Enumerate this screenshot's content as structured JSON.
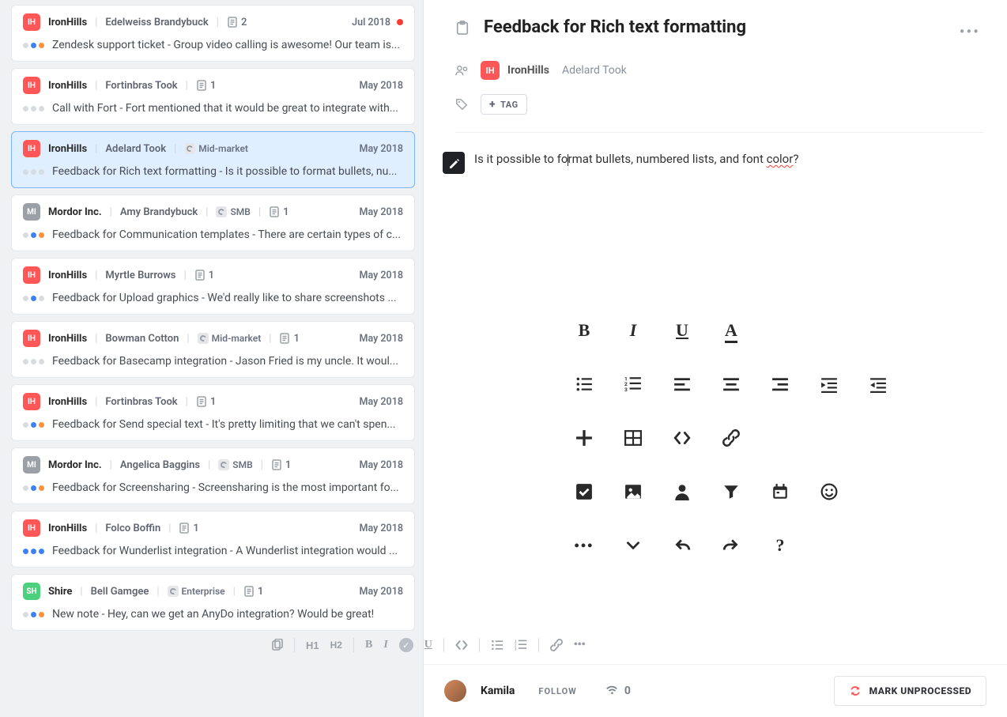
{
  "list": [
    {
      "orgCode": "IH",
      "orgClass": "org-ih",
      "org": "IronHills",
      "contact": "Edelweiss Brandybuck",
      "segment": null,
      "count": "2",
      "date": "Jul 2018",
      "redDot": true,
      "dotPattern": [
        "light",
        "blue",
        "orange"
      ],
      "summary": "Zendesk support ticket - Group video calling is awesome! Our team is...",
      "selected": false
    },
    {
      "orgCode": "IH",
      "orgClass": "org-ih",
      "org": "IronHills",
      "contact": "Fortinbras Took",
      "segment": null,
      "count": "1",
      "date": "May 2018",
      "redDot": false,
      "dotPattern": [
        "light",
        "light",
        "light"
      ],
      "summary": "Call with Fort - Fort mentioned that it would be great to integrate with...",
      "selected": false
    },
    {
      "orgCode": "IH",
      "orgClass": "org-ih",
      "org": "IronHills",
      "contact": "Adelard Took",
      "segment": "Mid-market",
      "count": null,
      "date": "May 2018",
      "redDot": false,
      "dotPattern": [
        "light",
        "light",
        "light"
      ],
      "summary": "Feedback for Rich text formatting - Is it possible to format bullets, nu...",
      "selected": true
    },
    {
      "orgCode": "MI",
      "orgClass": "org-mi",
      "org": "Mordor Inc.",
      "contact": "Amy Brandybuck",
      "segment": "SMB",
      "count": "1",
      "date": "May 2018",
      "redDot": false,
      "dotPattern": [
        "light",
        "blue",
        "orange"
      ],
      "summary": "Feedback for Communication templates - There are certain types of c...",
      "selected": false
    },
    {
      "orgCode": "IH",
      "orgClass": "org-ih",
      "org": "IronHills",
      "contact": "Myrtle Burrows",
      "segment": null,
      "count": "1",
      "date": "May 2018",
      "redDot": false,
      "dotPattern": [
        "light",
        "blue",
        "light"
      ],
      "summary": "Feedback for Upload graphics - We'd really like to share screenshots ...",
      "selected": false
    },
    {
      "orgCode": "IH",
      "orgClass": "org-ih",
      "org": "IronHills",
      "contact": "Bowman Cotton",
      "segment": "Mid-market",
      "count": "1",
      "date": "May 2018",
      "redDot": false,
      "dotPattern": [
        "light",
        "light",
        "light"
      ],
      "summary": "Feedback for Basecamp integration - Jason Fried is my uncle. It woul...",
      "selected": false
    },
    {
      "orgCode": "IH",
      "orgClass": "org-ih",
      "org": "IronHills",
      "contact": "Fortinbras Took",
      "segment": null,
      "count": "1",
      "date": "May 2018",
      "redDot": false,
      "dotPattern": [
        "light",
        "blue",
        "orange"
      ],
      "summary": "Feedback for Send special text - It's pretty limiting that we can't spen...",
      "selected": false
    },
    {
      "orgCode": "MI",
      "orgClass": "org-mi",
      "org": "Mordor Inc.",
      "contact": "Angelica Baggins",
      "segment": "SMB",
      "count": "1",
      "date": "May 2018",
      "redDot": false,
      "dotPattern": [
        "light",
        "blue",
        "orange"
      ],
      "summary": "Feedback for Screensharing - Screensharing is the most important fo...",
      "selected": false
    },
    {
      "orgCode": "IH",
      "orgClass": "org-ih",
      "org": "IronHills",
      "contact": "Folco Boffin",
      "segment": null,
      "count": "1",
      "date": "May 2018",
      "redDot": false,
      "dotPattern": [
        "blue",
        "blue",
        "blue"
      ],
      "summary": "Feedback for Wunderlist integration - A Wunderlist integration would ...",
      "selected": false
    },
    {
      "orgCode": "SH",
      "orgClass": "org-sh",
      "org": "Shire",
      "contact": "Bell Gamgee",
      "segment": "Enterprise",
      "count": "1",
      "date": "May 2018",
      "redDot": false,
      "dotPattern": [
        "light",
        "blue",
        "orange"
      ],
      "summary": "New note - Hey, can we get an AnyDo integration? Would be great!",
      "selected": false
    }
  ],
  "detail": {
    "title": "Feedback for Rich text formatting",
    "org": "IronHills",
    "orgCode": "IH",
    "contact": "Adelard Took",
    "addTag": "TAG",
    "bodyPrefix": "Is it possible to fo",
    "bodyMid": "rmat bullets, numbered lists, and font ",
    "bodySquiggle": "color",
    "bodySuffix": "?"
  },
  "palette": [
    [
      {
        "name": "bold-button",
        "kind": "char",
        "val": "B",
        "style": "font-weight:800;"
      },
      {
        "name": "italic-button",
        "kind": "char",
        "val": "I",
        "style": "font-style:italic;font-family:Georgia,serif;"
      },
      {
        "name": "underline-button",
        "kind": "uchar",
        "val": "U"
      },
      {
        "name": "font-color-button",
        "kind": "aul",
        "val": "A"
      },
      {
        "name": "",
        "kind": "empty"
      },
      {
        "name": "",
        "kind": "empty"
      },
      {
        "name": "",
        "kind": "empty"
      }
    ],
    [
      {
        "name": "bullet-list-button",
        "kind": "svg",
        "svg": "list-ul"
      },
      {
        "name": "number-list-button",
        "kind": "svg",
        "svg": "list-ol"
      },
      {
        "name": "align-left-button",
        "kind": "svg",
        "svg": "align-left"
      },
      {
        "name": "align-center-button",
        "kind": "svg",
        "svg": "align-center"
      },
      {
        "name": "align-right-button",
        "kind": "svg",
        "svg": "align-right"
      },
      {
        "name": "indent-in-button",
        "kind": "svg",
        "svg": "indent"
      },
      {
        "name": "indent-out-button",
        "kind": "svg",
        "svg": "outdent"
      }
    ],
    [
      {
        "name": "insert-button",
        "kind": "svg",
        "svg": "plus"
      },
      {
        "name": "table-button",
        "kind": "svg",
        "svg": "table"
      },
      {
        "name": "code-button",
        "kind": "svg",
        "svg": "code"
      },
      {
        "name": "link-button",
        "kind": "svg",
        "svg": "link"
      },
      {
        "name": "",
        "kind": "empty"
      },
      {
        "name": "",
        "kind": "empty"
      },
      {
        "name": "",
        "kind": "empty"
      }
    ],
    [
      {
        "name": "checkbox-button",
        "kind": "svg",
        "svg": "checkbox"
      },
      {
        "name": "image-button",
        "kind": "svg",
        "svg": "image"
      },
      {
        "name": "person-button",
        "kind": "svg",
        "svg": "person"
      },
      {
        "name": "filter-button",
        "kind": "svg",
        "svg": "funnel"
      },
      {
        "name": "date-button",
        "kind": "svg",
        "svg": "calendar"
      },
      {
        "name": "emoji-button",
        "kind": "svg",
        "svg": "smile"
      },
      {
        "name": "",
        "kind": "empty"
      }
    ],
    [
      {
        "name": "more-formatting-button",
        "kind": "char",
        "val": "•••",
        "style": "font-size:18px;letter-spacing:2px;"
      },
      {
        "name": "expand-button",
        "kind": "svg",
        "svg": "chev-down"
      },
      {
        "name": "undo-button",
        "kind": "svg",
        "svg": "undo"
      },
      {
        "name": "redo-button",
        "kind": "svg",
        "svg": "redo"
      },
      {
        "name": "help-button",
        "kind": "char",
        "val": "?",
        "style": "font-weight:800;"
      },
      {
        "name": "",
        "kind": "empty"
      },
      {
        "name": "",
        "kind": "empty"
      }
    ]
  ],
  "listToolbar": {
    "h1": "H1",
    "h2": "H2",
    "bold": "B",
    "italic": "I",
    "underline": "U"
  },
  "footer": {
    "user": "Kamila",
    "follow": "FOLLOW",
    "followers": "0",
    "markBtn": "MARK UNPROCESSED"
  }
}
